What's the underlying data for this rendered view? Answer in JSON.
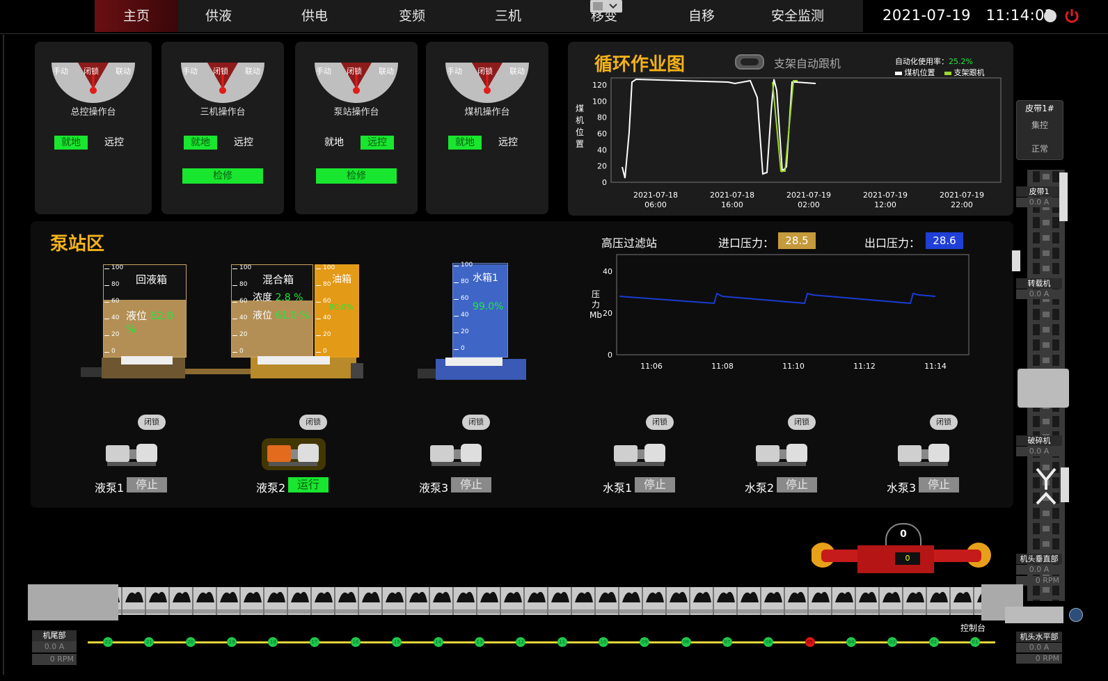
{
  "nav": {
    "items": [
      "主页",
      "供液",
      "供电",
      "变频",
      "三机",
      "移变",
      "自移",
      "安全监测"
    ],
    "active_index": 0,
    "date": "2021-07-19",
    "time": "11:14:02"
  },
  "consoles": [
    {
      "title": "总控操作台",
      "dial": [
        "手动",
        "闭锁",
        "联动"
      ],
      "local": "就地",
      "remote": "远控",
      "active": "local",
      "maint": ""
    },
    {
      "title": "三机操作台",
      "dial": [
        "手动",
        "闭锁",
        "联动"
      ],
      "local": "就地",
      "remote": "远控",
      "active": "local",
      "maint": "检修"
    },
    {
      "title": "泵站操作台",
      "dial": [
        "手动",
        "闭锁",
        "联动"
      ],
      "local": "就地",
      "remote": "远控",
      "active": "remote",
      "maint": "检修"
    },
    {
      "title": "煤机操作台",
      "dial": [
        "手动",
        "闭锁",
        "联动"
      ],
      "local": "就地",
      "remote": "远控",
      "active": "local",
      "maint": ""
    }
  ],
  "cycle_chart": {
    "title": "循环作业图",
    "toggle_label": "支架自动跟机",
    "auto_rate_label": "自动化使用率：",
    "auto_rate_value": "25.2%",
    "legend": [
      "煤机位置",
      "支架跟机"
    ],
    "ylabel": "煤机位置",
    "yticks": [
      "0",
      "20",
      "40",
      "60",
      "80",
      "100",
      "120"
    ],
    "xticks": [
      [
        "2021-07-18",
        "06:00"
      ],
      [
        "2021-07-18",
        "16:00"
      ],
      [
        "2021-07-19",
        "02:00"
      ],
      [
        "2021-07-19",
        "12:00"
      ],
      [
        "2021-07-19",
        "22:00"
      ]
    ]
  },
  "pump_station": {
    "title": "泵站区",
    "tanks": {
      "return_tank": {
        "name": "回液箱",
        "level_label": "液位",
        "level": "62.0",
        "unit": "%",
        "level_frac": 0.62
      },
      "mix_tank": {
        "name": "混合箱",
        "conc_label": "浓度",
        "conc": "2.8",
        "level_label": "液位",
        "level": "61.0",
        "unit": "%",
        "level_frac": 0.61
      },
      "oil_tank": {
        "name": "油箱",
        "level": "80.0%",
        "level_frac": 1.0
      },
      "water_tank": {
        "name": "水箱1",
        "level": "99.0%",
        "level_frac": 0.99
      }
    },
    "scale": [
      "100",
      "80",
      "60",
      "40",
      "20",
      "0"
    ]
  },
  "filter": {
    "title": "高压过滤站",
    "in_label": "进口压力：",
    "in_value": "28.5",
    "out_label": "出口压力：",
    "out_value": "28.6",
    "ylabel": "压力Mb",
    "yticks": [
      "0",
      "20",
      "40"
    ],
    "xticks": [
      "11:06",
      "11:08",
      "11:10",
      "11:12",
      "11:14"
    ]
  },
  "pumps": [
    {
      "name": "液泵1",
      "state": "停止",
      "lock": "闭锁",
      "running": false
    },
    {
      "name": "液泵2",
      "state": "运行",
      "lock": "闭锁",
      "running": true
    },
    {
      "name": "液泵3",
      "state": "停止",
      "lock": "闭锁",
      "running": false
    },
    {
      "name": "水泵1",
      "state": "停止",
      "lock": "闭锁",
      "running": false
    },
    {
      "name": "水泵2",
      "state": "停止",
      "lock": "闭锁",
      "running": false
    },
    {
      "name": "水泵3",
      "state": "停止",
      "lock": "闭锁",
      "running": false
    }
  ],
  "right_column": {
    "belt_box": {
      "title": "皮带1#",
      "mode": "集控",
      "status": "正常"
    },
    "belt1": {
      "label": "皮带1",
      "current": "0.0 A"
    },
    "transfer": {
      "label": "转载机",
      "current": "0.0 A"
    },
    "crusher": {
      "label": "破碎机",
      "current": "0.0 A"
    },
    "head_vertical": {
      "label": "机头垂直部",
      "current": "0.0 A",
      "rpm": "0 RPM"
    },
    "head_horizontal": {
      "label": "机头水平部",
      "current": "0.0 A",
      "rpm": "0 RPM"
    }
  },
  "conveyor": {
    "tail": {
      "label": "机尾部",
      "current": "0.0 A",
      "rpm": "0 RPM"
    },
    "control_label": "控制台",
    "shearer_value": "0",
    "shearer_small": "0",
    "nodes": [
      "22",
      "21",
      "20",
      "19",
      "18",
      "17",
      "16",
      "15",
      "14",
      "13",
      "12",
      "11",
      "10",
      "09",
      "08",
      "07",
      "06",
      "05",
      "04",
      "03",
      "02",
      "01"
    ],
    "red_node": "05"
  }
}
